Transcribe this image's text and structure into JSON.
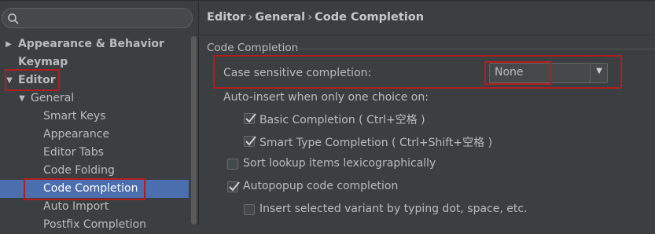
{
  "search": {
    "placeholder": ""
  },
  "tree": {
    "appearance_behavior": "Appearance & Behavior",
    "keymap": "Keymap",
    "editor": "Editor",
    "general": "General",
    "smart_keys": "Smart Keys",
    "appearance": "Appearance",
    "editor_tabs": "Editor Tabs",
    "code_folding": "Code Folding",
    "code_completion": "Code Completion",
    "auto_import": "Auto Import",
    "postfix_completion": "Postfix Completion"
  },
  "breadcrumb": {
    "part1": "Editor",
    "part2": "General",
    "part3": "Code Completion",
    "separator": "›"
  },
  "section": {
    "title": "Code Completion"
  },
  "case_sensitive": {
    "label": "Case sensitive completion:",
    "value": "None"
  },
  "auto_insert": {
    "label": "Auto-insert when only one choice on:",
    "basic": "Basic Completion ( Ctrl+空格 )",
    "smart": "Smart Type Completion ( Ctrl+Shift+空格 )"
  },
  "options": {
    "sort_lookup": "Sort lookup items lexicographically",
    "autopopup": "Autopopup code completion",
    "insert_variant": "Insert selected variant by typing dot, space, etc."
  },
  "checkbox_states": {
    "basic": true,
    "smart": true,
    "sort_lookup": false,
    "autopopup": true,
    "insert_variant": false
  },
  "colors": {
    "background": "#3c3f41",
    "selection": "#4b6eaf",
    "highlight_box": "#b01e1e",
    "text": "#bbbbbb"
  },
  "icons": {
    "search": "search-icon",
    "expand": "triangle-right-icon",
    "collapse": "triangle-down-icon",
    "dropdown": "caret-down-icon",
    "check": "checkmark-icon"
  }
}
